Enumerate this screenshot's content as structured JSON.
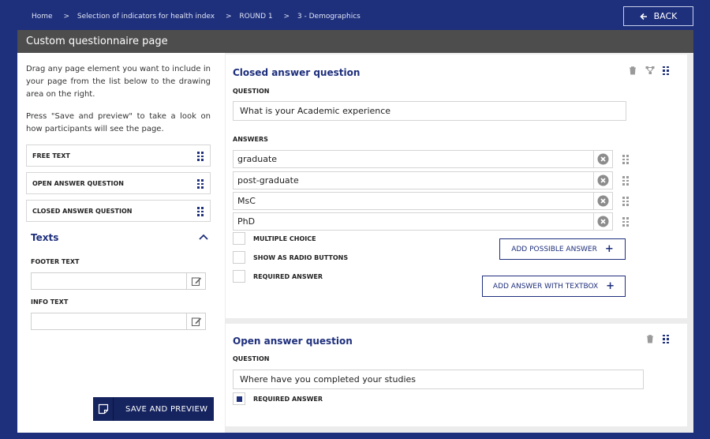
{
  "breadcrumb": {
    "home": "Home",
    "sep": ">",
    "indicator": "Selection of indicators for health index",
    "round": "ROUND 1",
    "step": "3 - Demographics"
  },
  "back_button": {
    "label": "BACK"
  },
  "page": {
    "title": "Custom questionnaire page"
  },
  "left": {
    "intro_1": "Drag any page element you want to include in your page from the list below to the drawing area on the right.",
    "intro_2": "Press \"Save and preview\" to take a look on how participants will see the page.",
    "elements": [
      "FREE TEXT",
      "OPEN ANSWER QUESTION",
      "CLOSED ANSWER QUESTION"
    ],
    "texts_heading": "Texts",
    "footer_label": "FOOTER TEXT",
    "footer_value": "",
    "info_label": "INFO TEXT",
    "info_value": "",
    "save_label": "SAVE AND PREVIEW"
  },
  "closed_card": {
    "title": "Closed answer question",
    "question_label": "QUESTION",
    "question_value": "What is your Academic experience",
    "answers_label": "ANSWERS",
    "answers": [
      "graduate",
      "post-graduate",
      "MsC",
      "PhD"
    ],
    "options": [
      {
        "label": "MULTIPLE CHOICE",
        "checked": false
      },
      {
        "label": "SHOW AS RADIO BUTTONS",
        "checked": false
      },
      {
        "label": "REQUIRED ANSWER",
        "checked": false
      }
    ],
    "add_answer_label": "ADD POSSIBLE ANSWER",
    "add_textbox_label": "ADD ANSWER WITH TEXTBOX"
  },
  "open_card": {
    "title": "Open answer question",
    "question_label": "QUESTION",
    "question_value": "Where have you completed your studies",
    "required_label": "REQUIRED ANSWER",
    "required_checked": true
  },
  "colors": {
    "brand": "#1e2f7c",
    "header": "#4d4d4d",
    "panel_bg": "#ececec"
  },
  "icons": {
    "back": "arrow-left-icon",
    "drag": "drag-handle-icon",
    "collapse": "chevron-up-icon",
    "edit": "edit-icon",
    "save": "note-icon",
    "delete": "trash-icon",
    "branch": "branch-icon",
    "remove": "close-circle-icon",
    "add": "plus-icon"
  }
}
